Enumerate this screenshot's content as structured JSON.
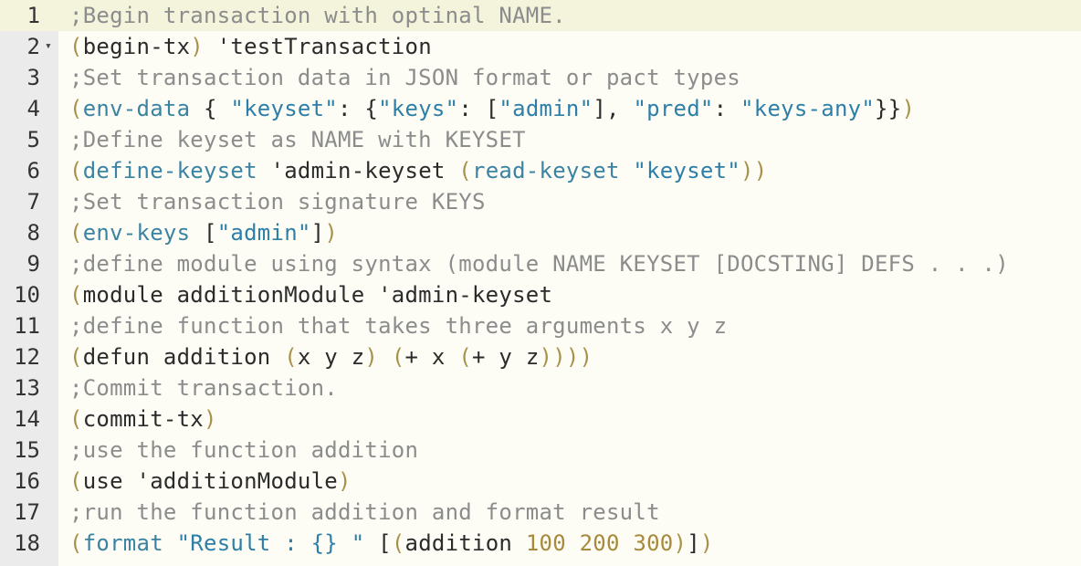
{
  "colors": {
    "comment": "#8c8c8c",
    "paren": "#a8914b",
    "keyword": "#3b83a2",
    "string": "#2e7fa8",
    "number": "#a88a3c",
    "default": "#2b2b2b",
    "gutter_bg": "#ebebeb",
    "active_line_bg": "#f4f4dc"
  },
  "editor": {
    "fold_icon": "fold-triangle-icon",
    "lines": [
      {
        "n": "1",
        "active": true,
        "tokens": [
          [
            "cm",
            ";Begin transaction with optinal NAME."
          ]
        ]
      },
      {
        "n": "2",
        "fold": "▾",
        "tokens": [
          [
            "p",
            "("
          ],
          [
            "df",
            "begin-tx"
          ],
          [
            "p",
            ")"
          ],
          [
            "df",
            " 'testTransaction"
          ]
        ]
      },
      {
        "n": "3",
        "tokens": [
          [
            "cm",
            ";Set transaction data in JSON format or pact types"
          ]
        ]
      },
      {
        "n": "4",
        "tokens": [
          [
            "p",
            "("
          ],
          [
            "kw",
            "env-data"
          ],
          [
            "df",
            " { "
          ],
          [
            "st",
            "\"keyset\""
          ],
          [
            "df",
            ": {"
          ],
          [
            "st",
            "\"keys\""
          ],
          [
            "df",
            ": ["
          ],
          [
            "st",
            "\"admin\""
          ],
          [
            "df",
            "], "
          ],
          [
            "st",
            "\"pred\""
          ],
          [
            "df",
            ": "
          ],
          [
            "st",
            "\"keys-any\""
          ],
          [
            "df",
            "}}"
          ],
          [
            "p",
            ")"
          ]
        ]
      },
      {
        "n": "5",
        "tokens": [
          [
            "cm",
            ";Define keyset as NAME with KEYSET"
          ]
        ]
      },
      {
        "n": "6",
        "tokens": [
          [
            "p",
            "("
          ],
          [
            "kw",
            "define-keyset"
          ],
          [
            "df",
            " 'admin-keyset "
          ],
          [
            "p",
            "("
          ],
          [
            "kw",
            "read-keyset"
          ],
          [
            "df",
            " "
          ],
          [
            "st",
            "\"keyset\""
          ],
          [
            "p",
            "))"
          ]
        ]
      },
      {
        "n": "7",
        "tokens": [
          [
            "cm",
            ";Set transaction signature KEYS"
          ]
        ]
      },
      {
        "n": "8",
        "tokens": [
          [
            "p",
            "("
          ],
          [
            "kw",
            "env-keys"
          ],
          [
            "df",
            " ["
          ],
          [
            "st",
            "\"admin\""
          ],
          [
            "df",
            "]"
          ],
          [
            "p",
            ")"
          ]
        ]
      },
      {
        "n": "9",
        "tokens": [
          [
            "cm",
            ";define module using syntax (module NAME KEYSET [DOCSTING] DEFS . . .)"
          ]
        ]
      },
      {
        "n": "10",
        "tokens": [
          [
            "p",
            "("
          ],
          [
            "df",
            "module additionModule 'admin-keyset"
          ]
        ]
      },
      {
        "n": "11",
        "tokens": [
          [
            "cm",
            ";define function that takes three arguments x y z"
          ]
        ]
      },
      {
        "n": "12",
        "tokens": [
          [
            "p",
            "("
          ],
          [
            "df",
            "defun addition "
          ],
          [
            "p",
            "("
          ],
          [
            "df",
            "x y z"
          ],
          [
            "p",
            ")"
          ],
          [
            "df",
            " "
          ],
          [
            "p",
            "("
          ],
          [
            "df",
            "+ x "
          ],
          [
            "p",
            "("
          ],
          [
            "df",
            "+ y z"
          ],
          [
            "p",
            "))))"
          ]
        ]
      },
      {
        "n": "13",
        "tokens": [
          [
            "cm",
            ";Commit transaction."
          ]
        ]
      },
      {
        "n": "14",
        "tokens": [
          [
            "p",
            "("
          ],
          [
            "df",
            "commit-tx"
          ],
          [
            "p",
            ")"
          ]
        ]
      },
      {
        "n": "15",
        "tokens": [
          [
            "cm",
            ";use the function addition"
          ]
        ]
      },
      {
        "n": "16",
        "tokens": [
          [
            "p",
            "("
          ],
          [
            "df",
            "use 'additionModule"
          ],
          [
            "p",
            ")"
          ]
        ]
      },
      {
        "n": "17",
        "tokens": [
          [
            "cm",
            ";run the function addition and format result"
          ]
        ]
      },
      {
        "n": "18",
        "tokens": [
          [
            "p",
            "("
          ],
          [
            "kw",
            "format"
          ],
          [
            "df",
            " "
          ],
          [
            "st",
            "\"Result : {} \""
          ],
          [
            "df",
            " ["
          ],
          [
            "p",
            "("
          ],
          [
            "df",
            "addition "
          ],
          [
            "nm",
            "100 200 300"
          ],
          [
            "p",
            ")"
          ],
          [
            "df",
            "]"
          ],
          [
            "p",
            ")"
          ]
        ]
      }
    ]
  }
}
